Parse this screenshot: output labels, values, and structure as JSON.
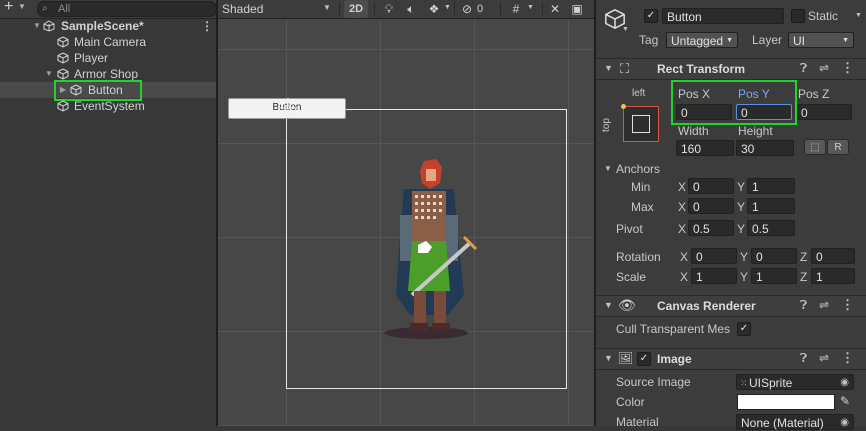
{
  "hierarchy": {
    "add_label": "+",
    "search_placeholder": "All",
    "items": [
      {
        "label": "SampleScene*"
      },
      {
        "label": "Main Camera"
      },
      {
        "label": "Player"
      },
      {
        "label": "Armor Shop"
      },
      {
        "label": "Button"
      },
      {
        "label": "EventSystem"
      }
    ]
  },
  "scene": {
    "shading_mode": "Shaded",
    "mode_2d": "2D",
    "hidden_count": "0",
    "canvas_button_text": "Button"
  },
  "inspector": {
    "object_name": "Button",
    "static_label": "Static",
    "tag_label": "Tag",
    "tag_value": "Untagged",
    "layer_label": "Layer",
    "layer_value": "UI",
    "rect_transform": {
      "title": "Rect Transform",
      "anchor_h": "left",
      "anchor_v": "top",
      "pos_x_label": "Pos X",
      "pos_y_label": "Pos Y",
      "pos_z_label": "Pos Z",
      "pos_x": "0",
      "pos_y": "0",
      "pos_z": "0",
      "width_label": "Width",
      "height_label": "Height",
      "width": "160",
      "height": "30",
      "r_button": "R",
      "anchors_label": "Anchors",
      "min_label": "Min",
      "max_label": "Max",
      "min_x": "0",
      "min_y": "1",
      "max_x": "0",
      "max_y": "1",
      "pivot_label": "Pivot",
      "pivot_x": "0.5",
      "pivot_y": "0.5",
      "rotation_label": "Rotation",
      "rot_x": "0",
      "rot_y": "0",
      "rot_z": "0",
      "scale_label": "Scale",
      "scale_x": "1",
      "scale_y": "1",
      "scale_z": "1",
      "x": "X",
      "y": "Y",
      "z": "Z"
    },
    "canvas_renderer": {
      "title": "Canvas Renderer",
      "cull_label": "Cull Transparent Mes"
    },
    "image": {
      "title": "Image",
      "source_image_label": "Source Image",
      "source_image_value": "UISprite",
      "color_label": "Color",
      "material_label": "Material",
      "material_value": "None (Material)"
    }
  },
  "colors": {
    "highlight": "#22d42a",
    "selection": "#4a4a4a",
    "accent_text": "#7aa4ff"
  }
}
